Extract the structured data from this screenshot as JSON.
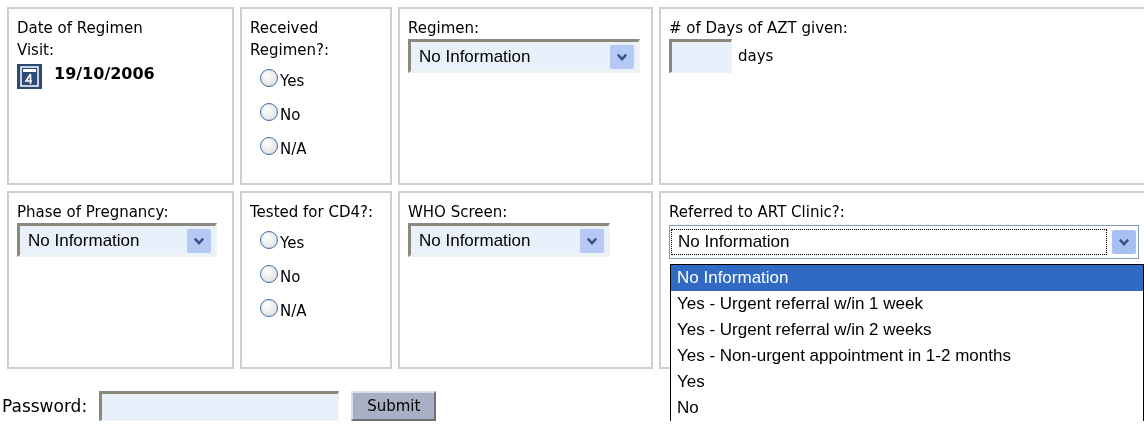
{
  "fields": [
    {
      "kind": "date",
      "label": "Date of Regimen Visit:",
      "value": "19/10/2006"
    },
    {
      "kind": "radio",
      "label": "Received Regimen?:",
      "options": [
        {
          "label": "Yes",
          "selected": false
        },
        {
          "label": "No",
          "selected": false
        },
        {
          "label": "N/A",
          "selected": false
        }
      ]
    },
    {
      "kind": "select",
      "label": "Regimen:",
      "value": "No Information",
      "focused": false,
      "expanded": false
    },
    {
      "kind": "number",
      "label": "# of Days of AZT given:",
      "unit": "days"
    },
    {
      "kind": "select",
      "label": "Phase of Pregnancy:",
      "value": "No Information",
      "focused": false,
      "expanded": false
    },
    {
      "kind": "radio",
      "label": "Tested for CD4?:",
      "options": [
        {
          "label": "Yes",
          "selected": false
        },
        {
          "label": "No",
          "selected": false
        },
        {
          "label": "N/A",
          "selected": false
        }
      ]
    },
    {
      "kind": "select",
      "label": "WHO Screen:",
      "value": "No Information",
      "focused": false,
      "expanded": false
    },
    {
      "kind": "select",
      "label": "Referred to ART Clinic?:",
      "value": "No Information",
      "focused": true,
      "expanded": true,
      "options": [
        {
          "label": "No Information",
          "selected": true
        },
        {
          "label": "Yes - Urgent referral w/in 1 week",
          "selected": false
        },
        {
          "label": "Yes - Urgent referral w/in 2 weeks",
          "selected": false
        },
        {
          "label": "Yes - Non-urgent appointment in 1-2 months",
          "selected": false
        },
        {
          "label": "Yes",
          "selected": false
        },
        {
          "label": "No",
          "selected": false
        }
      ]
    }
  ],
  "password": {
    "label": "Password:"
  },
  "submit": "Submit"
}
